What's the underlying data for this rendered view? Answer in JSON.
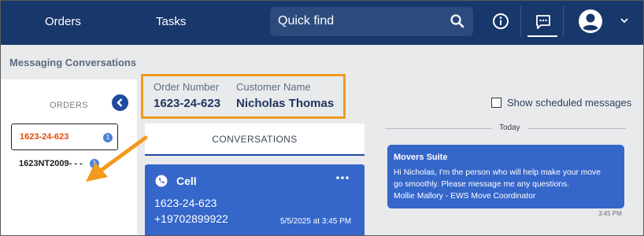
{
  "nav": {
    "orders": "Orders",
    "tasks": "Tasks",
    "search_label": "Quick find"
  },
  "page_title": "Messaging Conversations",
  "left_panel": {
    "orders_label": "ORDERS",
    "items": [
      {
        "label": "1623-24-623",
        "badge": "1"
      },
      {
        "label": "1623NT2009- - -",
        "badge": "1"
      }
    ]
  },
  "header": {
    "order_number_label": "Order Number",
    "order_number": "1623-24-623",
    "customer_name_label": "Customer Name",
    "customer_name": "Nicholas Thomas"
  },
  "show_scheduled": "Show scheduled messages",
  "conversations_tab": "CONVERSATIONS",
  "cell_card": {
    "title": "Cell",
    "order": "1623-24-623",
    "phone": "+19702899922",
    "date": "5/5/2025 at 3:45 PM"
  },
  "today_label": "Today",
  "message": {
    "sender": "Movers Suite",
    "line1": "Hi Nicholas, I'm the person who will help make your move",
    "line2": "go smoothly. Please message me any questions.",
    "line3": "Mollie Mallory - EWS Move Coordinator",
    "time": "3:45 PM"
  },
  "colors": {
    "nav_bg": "#18376b",
    "accent_blue": "#3566c9",
    "annotation_orange": "#f29a1e",
    "active_order_text": "#e24a0e"
  }
}
